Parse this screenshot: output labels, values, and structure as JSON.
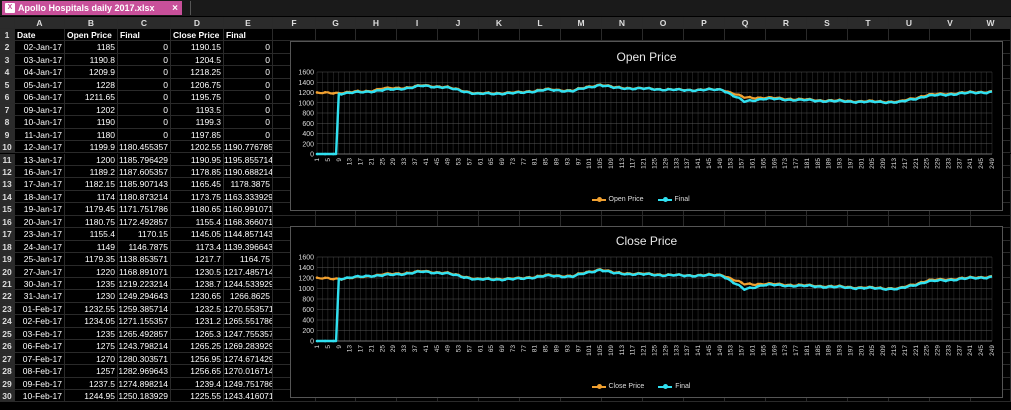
{
  "tab": {
    "icon": "excel-file-icon",
    "title": "Apollo Hospitals daily 2017.xlsx",
    "close": "×"
  },
  "columns": [
    "A",
    "B",
    "C",
    "D",
    "E",
    "F",
    "G",
    "H",
    "I",
    "J",
    "K",
    "L",
    "M",
    "N",
    "O",
    "P",
    "Q",
    "R",
    "S",
    "T",
    "U",
    "V",
    "W"
  ],
  "headers": [
    "Date",
    "Open Price",
    "Final",
    "Close Price",
    "Final"
  ],
  "rows": [
    [
      "02-Jan-17",
      "1185",
      "0",
      "1190.15",
      "0"
    ],
    [
      "03-Jan-17",
      "1190.8",
      "0",
      "1204.5",
      "0"
    ],
    [
      "04-Jan-17",
      "1209.9",
      "0",
      "1218.25",
      "0"
    ],
    [
      "05-Jan-17",
      "1228",
      "0",
      "1206.75",
      "0"
    ],
    [
      "06-Jan-17",
      "1211.65",
      "0",
      "1195.75",
      "0"
    ],
    [
      "09-Jan-17",
      "1202",
      "0",
      "1193.5",
      "0"
    ],
    [
      "10-Jan-17",
      "1190",
      "0",
      "1199.3",
      "0"
    ],
    [
      "11-Jan-17",
      "1180",
      "0",
      "1197.85",
      "0"
    ],
    [
      "12-Jan-17",
      "1199.9",
      "1180.455357",
      "1202.55",
      "1190.776785"
    ],
    [
      "13-Jan-17",
      "1200",
      "1185.796429",
      "1190.95",
      "1195.855714"
    ],
    [
      "16-Jan-17",
      "1189.2",
      "1187.605357",
      "1178.85",
      "1190.688214"
    ],
    [
      "17-Jan-17",
      "1182.15",
      "1185.907143",
      "1165.45",
      "1178.3875"
    ],
    [
      "18-Jan-17",
      "1174",
      "1180.873214",
      "1173.75",
      "1163.333929"
    ],
    [
      "19-Jan-17",
      "1179.45",
      "1171.751786",
      "1180.65",
      "1160.991071"
    ],
    [
      "20-Jan-17",
      "1180.75",
      "1172.492857",
      "1155.4",
      "1168.366071"
    ],
    [
      "23-Jan-17",
      "1155.4",
      "1170.15",
      "1145.05",
      "1144.857143"
    ],
    [
      "24-Jan-17",
      "1149",
      "1146.7875",
      "1173.4",
      "1139.396643"
    ],
    [
      "25-Jan-17",
      "1179.35",
      "1138.853571",
      "1217.7",
      "1164.75"
    ],
    [
      "27-Jan-17",
      "1220",
      "1168.891071",
      "1230.5",
      "1217.485714"
    ],
    [
      "30-Jan-17",
      "1235",
      "1219.223214",
      "1238.7",
      "1244.533929"
    ],
    [
      "31-Jan-17",
      "1230",
      "1249.294643",
      "1230.65",
      "1266.8625"
    ],
    [
      "01-Feb-17",
      "1232.55",
      "1259.385714",
      "1232.5",
      "1270.553571"
    ],
    [
      "02-Feb-17",
      "1234.05",
      "1271.155357",
      "1231.2",
      "1265.551786"
    ],
    [
      "03-Feb-17",
      "1235",
      "1265.492857",
      "1265.3",
      "1247.755357"
    ],
    [
      "06-Feb-17",
      "1275",
      "1243.798214",
      "1265.25",
      "1269.283929"
    ],
    [
      "07-Feb-17",
      "1270",
      "1280.303571",
      "1256.95",
      "1274.671429"
    ],
    [
      "08-Feb-17",
      "1257",
      "1282.969643",
      "1256.65",
      "1270.016714"
    ],
    [
      "09-Feb-17",
      "1237.5",
      "1274.898214",
      "1239.4",
      "1249.751786"
    ],
    [
      "10-Feb-17",
      "1244.95",
      "1250.183929",
      "1225.55",
      "1243.416071"
    ]
  ],
  "charts": [
    {
      "title": "Open Price",
      "chart_data": {
        "type": "line",
        "ylim": [
          0,
          1600
        ],
        "yticks": [
          "0",
          "200",
          "400",
          "600",
          "800",
          "1000",
          "1200",
          "1400",
          "1600"
        ],
        "xticks": [
          "1",
          "5",
          "9",
          "13",
          "17",
          "21",
          "25",
          "29",
          "33",
          "37",
          "41",
          "45",
          "49",
          "53",
          "57",
          "61",
          "65",
          "69",
          "73",
          "77",
          "81",
          "85",
          "89",
          "93",
          "97",
          "101",
          "105",
          "109",
          "113",
          "117",
          "121",
          "125",
          "129",
          "133",
          "137",
          "141",
          "145",
          "149",
          "153",
          "157",
          "161",
          "165",
          "169",
          "173",
          "177",
          "181",
          "185",
          "189",
          "193",
          "197",
          "201",
          "205",
          "209",
          "213",
          "217",
          "221",
          "225",
          "229",
          "233",
          "237",
          "241",
          "245",
          "249"
        ],
        "x_count": 249,
        "series": [
          {
            "name": "Open Price",
            "color": "#f0a030",
            "anchors": [
              [
                1,
                1185
              ],
              [
                12,
                1200
              ],
              [
                20,
                1230
              ],
              [
                25,
                1275
              ],
              [
                35,
                1300
              ],
              [
                40,
                1340
              ],
              [
                48,
                1310
              ],
              [
                60,
                1180
              ],
              [
                75,
                1200
              ],
              [
                85,
                1260
              ],
              [
                95,
                1240
              ],
              [
                105,
                1360
              ],
              [
                110,
                1300
              ],
              [
                120,
                1280
              ],
              [
                135,
                1250
              ],
              [
                150,
                1260
              ],
              [
                158,
                1100
              ],
              [
                165,
                1100
              ],
              [
                185,
                1050
              ],
              [
                200,
                1030
              ],
              [
                215,
                1020
              ],
              [
                225,
                1150
              ],
              [
                240,
                1200
              ],
              [
                249,
                1220
              ]
            ]
          },
          {
            "name": "Final",
            "color": "#30e0f0",
            "anchors": [
              [
                1,
                0
              ],
              [
                8,
                0
              ],
              [
                9,
                1180
              ],
              [
                12,
                1186
              ],
              [
                20,
                1219
              ],
              [
                25,
                1243
              ],
              [
                35,
                1290
              ],
              [
                40,
                1330
              ],
              [
                48,
                1300
              ],
              [
                60,
                1170
              ],
              [
                75,
                1190
              ],
              [
                85,
                1250
              ],
              [
                95,
                1230
              ],
              [
                105,
                1350
              ],
              [
                110,
                1290
              ],
              [
                120,
                1275
              ],
              [
                135,
                1245
              ],
              [
                150,
                1255
              ],
              [
                158,
                1020
              ],
              [
                165,
                1080
              ],
              [
                185,
                1040
              ],
              [
                200,
                1020
              ],
              [
                215,
                1010
              ],
              [
                225,
                1130
              ],
              [
                240,
                1190
              ],
              [
                249,
                1210
              ]
            ]
          }
        ]
      }
    },
    {
      "title": "Close Price",
      "chart_data": {
        "type": "line",
        "ylim": [
          0,
          1600
        ],
        "yticks": [
          "0",
          "200",
          "400",
          "600",
          "800",
          "1000",
          "1200",
          "1400",
          "1600"
        ],
        "xticks": [
          "1",
          "5",
          "9",
          "13",
          "17",
          "21",
          "25",
          "29",
          "33",
          "37",
          "41",
          "45",
          "49",
          "53",
          "57",
          "61",
          "65",
          "69",
          "73",
          "77",
          "81",
          "85",
          "89",
          "93",
          "97",
          "101",
          "105",
          "109",
          "113",
          "117",
          "121",
          "125",
          "129",
          "133",
          "137",
          "141",
          "145",
          "149",
          "153",
          "157",
          "161",
          "165",
          "169",
          "173",
          "177",
          "181",
          "185",
          "189",
          "193",
          "197",
          "201",
          "205",
          "209",
          "213",
          "217",
          "221",
          "225",
          "229",
          "233",
          "237",
          "241",
          "245",
          "249"
        ],
        "x_count": 249,
        "series": [
          {
            "name": "Close Price",
            "color": "#f0a030",
            "anchors": [
              [
                1,
                1190
              ],
              [
                12,
                1190
              ],
              [
                20,
                1238
              ],
              [
                25,
                1265
              ],
              [
                35,
                1300
              ],
              [
                40,
                1330
              ],
              [
                48,
                1300
              ],
              [
                60,
                1180
              ],
              [
                75,
                1190
              ],
              [
                85,
                1250
              ],
              [
                95,
                1240
              ],
              [
                105,
                1370
              ],
              [
                110,
                1300
              ],
              [
                120,
                1280
              ],
              [
                135,
                1250
              ],
              [
                150,
                1260
              ],
              [
                158,
                1080
              ],
              [
                165,
                1090
              ],
              [
                185,
                1050
              ],
              [
                200,
                1020
              ],
              [
                215,
                1000
              ],
              [
                225,
                1150
              ],
              [
                240,
                1200
              ],
              [
                249,
                1230
              ]
            ]
          },
          {
            "name": "Final",
            "color": "#30e0f0",
            "anchors": [
              [
                1,
                0
              ],
              [
                8,
                0
              ],
              [
                9,
                1190
              ],
              [
                12,
                1196
              ],
              [
                20,
                1244
              ],
              [
                25,
                1247
              ],
              [
                35,
                1290
              ],
              [
                40,
                1320
              ],
              [
                48,
                1290
              ],
              [
                60,
                1170
              ],
              [
                75,
                1180
              ],
              [
                85,
                1240
              ],
              [
                95,
                1230
              ],
              [
                105,
                1360
              ],
              [
                110,
                1290
              ],
              [
                120,
                1270
              ],
              [
                135,
                1245
              ],
              [
                150,
                1250
              ],
              [
                158,
                980
              ],
              [
                165,
                1070
              ],
              [
                185,
                1040
              ],
              [
                200,
                1010
              ],
              [
                215,
                990
              ],
              [
                225,
                1130
              ],
              [
                240,
                1190
              ],
              [
                249,
                1220
              ]
            ]
          }
        ]
      }
    }
  ]
}
